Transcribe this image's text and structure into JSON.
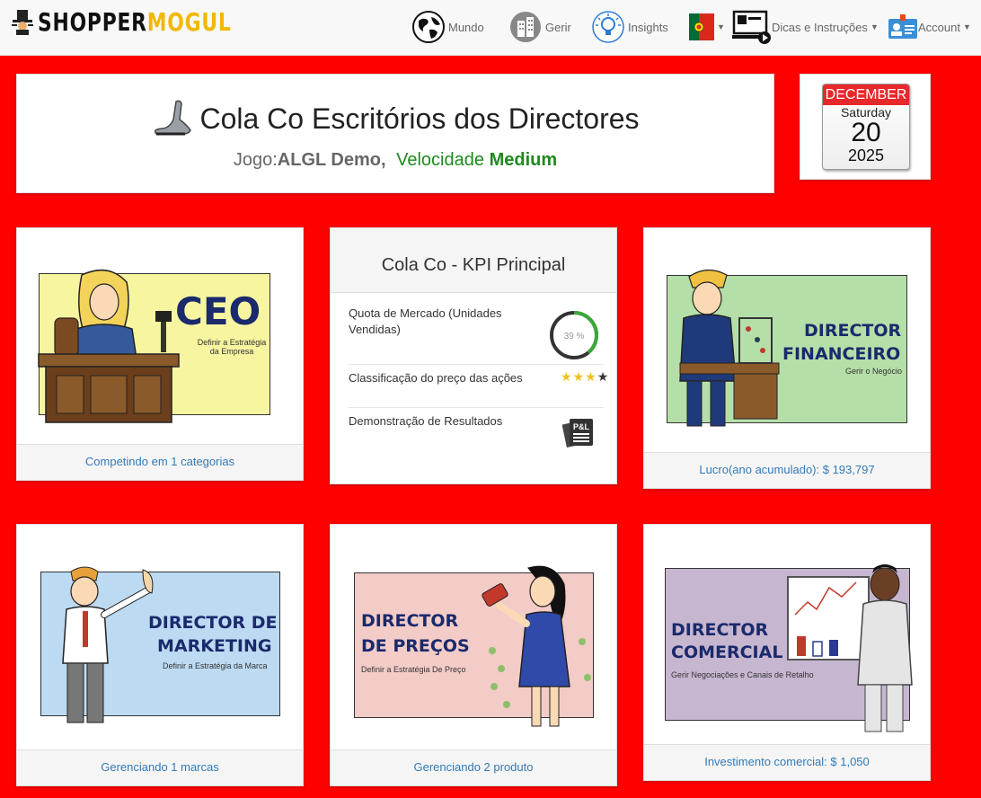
{
  "navbar": {
    "brand_a": "SHOPPER",
    "brand_b": "MOGUL",
    "items": [
      {
        "label": "Mundo",
        "icon": "globe-icon"
      },
      {
        "label": "Gerir",
        "icon": "buildings-icon"
      },
      {
        "label": "Insights",
        "icon": "lightbulb-icon"
      },
      {
        "label": "",
        "icon": "portugal-flag-icon"
      },
      {
        "label": "Dicas e Instruções",
        "icon": "tutorial-video-icon"
      },
      {
        "label": "Account",
        "icon": "id-card-icon"
      }
    ]
  },
  "header": {
    "title": "Cola Co Escritórios dos Directores",
    "jogo_label": "Jogo:",
    "jogo_name": "ALGL Demo,",
    "velocidade_label": "Velocidade",
    "velocidade_value": "Medium"
  },
  "calendar": {
    "month": "DECEMBER",
    "weekday": "Saturday",
    "day": "20",
    "year": "2025"
  },
  "cards": {
    "ceo": {
      "title": "CEO",
      "subtitle": "Definir a Estratégia da Empresa",
      "footer": "Competindo em 1 categorias"
    },
    "financeiro": {
      "title_1": "DIRECTOR",
      "title_2": "FINANCEIRO",
      "subtitle": "Gerir o Negócio",
      "footer": "Lucro(ano acumulado): $ 193,797"
    },
    "marketing": {
      "title_1": "DIRECTOR DE",
      "title_2": "MARKETING",
      "subtitle": "Definir a Estratégia da Marca",
      "footer": "Gerenciando 1 marcas"
    },
    "precos": {
      "title_1": "DIRECTOR",
      "title_2": "DE PREÇOS",
      "subtitle": "Definir a Estratégia De Preço",
      "footer": "Gerenciando 2 produto"
    },
    "comercial": {
      "title_1": "DIRECTOR",
      "title_2": "COMERCIAL",
      "subtitle": "Gerir Negociações e Canais de Retalho",
      "footer": "Investimento comercial: $ 1,050"
    }
  },
  "kpi": {
    "title": "Cola Co - KPI Principal",
    "market_share_label": "Quota de Mercado (Unidades Vendidas)",
    "market_share_value": 39,
    "market_share_text": "39 %",
    "stock_rating_label": "Classificação do preço das ações",
    "stock_rating": 3,
    "stock_rating_max": 4,
    "income_statement_label": "Demonstração de Resultados",
    "pl_icon_text": "P&L"
  },
  "colors": {
    "background": "#ff0000",
    "brand_accent": "#f0b800",
    "velocity": "#1e8a1e",
    "link": "#337ab7",
    "star": "#f0c020",
    "gauge": "#3aa83a"
  }
}
